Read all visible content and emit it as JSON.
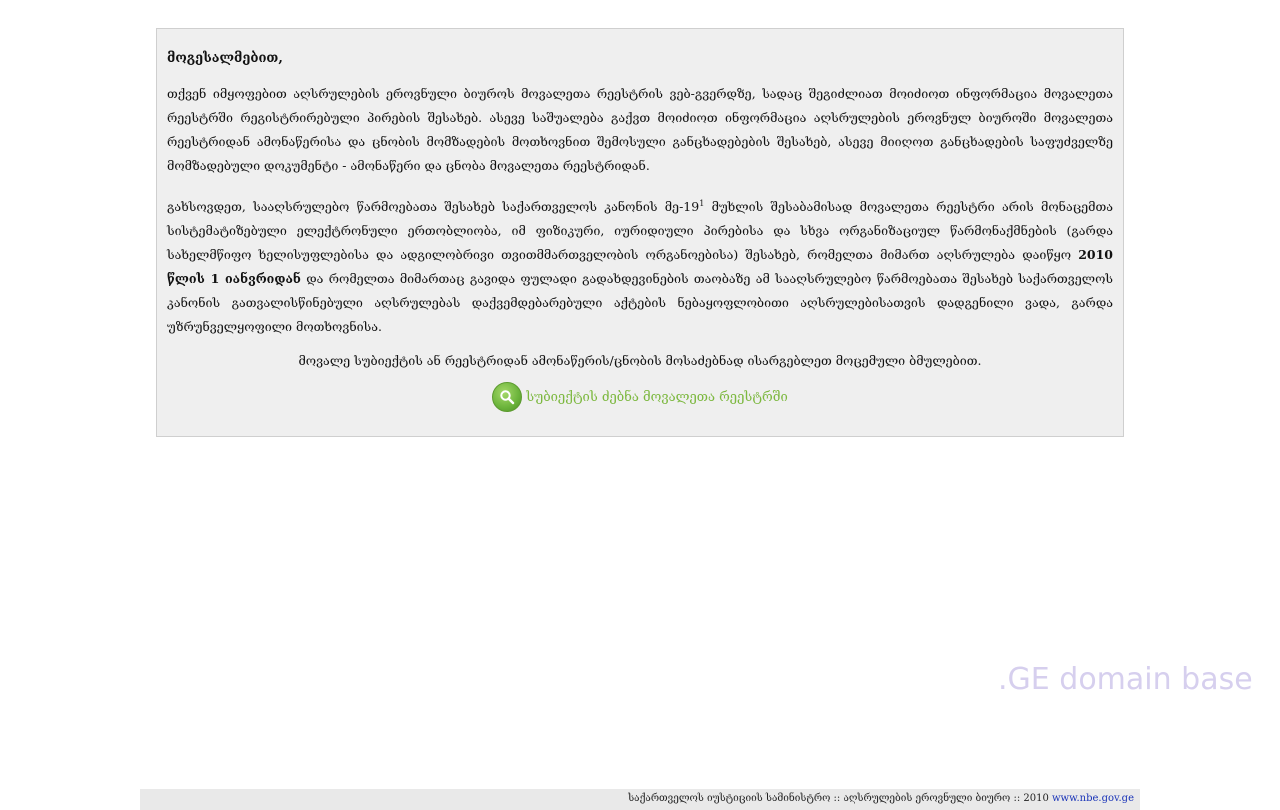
{
  "greeting": "მოგესალმებით,",
  "intro": "თქვენ იმყოფებით აღსრულების ეროვნული ბიუროს მოვალეთა რეესტრის ვებ-გვერდზე, სადაც შეგიძლიათ მოიძიოთ ინფორმაცია მოვალეთა რეესტრში რეგისტრირებული პირების შესახებ. ასევე საშუალება გაქვთ მოიძიოთ ინფორმაცია აღსრულების ეროვნულ ბიუროში მოვალეთა რეესტრიდან ამონაწერისა და ცნობის მომზადების მოთხოვნით შემოსული განცხადებების შესახებ, ასევე მიიღოთ განცხადების საფუძველზე მომზადებული დოკუმენტი - ამონაწერი და ცნობა მოვალეთა რეესტრიდან.",
  "reminder": {
    "part1": "გახსოვდეთ, სააღსრულებო წარმოებათა შესახებ საქართველოს კანონის მე-19",
    "sup": "1",
    "part2": " მუხლის შესაბამისად მოვალეთა რეესტრი არის მონაცემთა სისტემატიზებული ელექტრონული ერთობლიობა, იმ ფიზიკური, იურიდიული პირებისა და სხვა ორგანიზაციულ წარმონაქმნების (გარდა სახელმწიფო ხელისუფლებისა და ადგილობრივი თვითმმართველობის ორგანოებისა) შესახებ, რომელთა მიმართ აღსრულება დაიწყო ",
    "bold": "2010 წლის 1 იანვრიდან",
    "part3": " და რომელთა მიმართაც გავიდა ფულადი გადახდევინების თაობაზე ამ სააღსრულებო წარმოებათა შესახებ საქართველოს კანონის გათვალისწინებული აღსრულებას დაქვემდებარებული აქტების ნებაყოფლობითი აღსრულებისათვის დადგენილი ვადა, გარდა უზრუნველყოფილი მოთხოვნისა."
  },
  "note": "მოვალე სუბიექტის ან რეესტრიდან ამონაწერის/ცნობის მოსაძებნად ისარგებლეთ მოცემული ბმულებით.",
  "search_link": {
    "label": "სუბიექტის ძებნა მოვალეთა რეესტრში",
    "icon": "search-icon"
  },
  "watermark": ".GE domain base",
  "footer": {
    "text": "საქართველოს იუსტიციის სამინისტრო :: აღსრულების ეროვნული ბიურო :: 2010 ",
    "link": "www.nbe.gov.ge"
  },
  "colors": {
    "accent": "#7cb83f",
    "panel": "#efefef",
    "link": "#1a34b8"
  }
}
